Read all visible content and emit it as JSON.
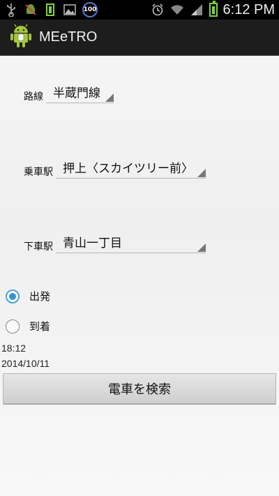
{
  "status_bar": {
    "icons_left": [
      "usb-icon",
      "android-debug-icon",
      "battery-100-icon",
      "image-icon",
      "badge-100-icon"
    ],
    "badge_text": "100",
    "icons_right": [
      "alarm-icon",
      "wifi-icon",
      "signal-icon",
      "battery-icon"
    ],
    "time": "6:12 PM"
  },
  "action_bar": {
    "title": "MEeTRO",
    "icon": "android-app-icon"
  },
  "form": {
    "line": {
      "label": "路線",
      "value": "半蔵門線"
    },
    "from": {
      "label": "乗車駅",
      "value": "押上〈スカイツリー前〉"
    },
    "to": {
      "label": "下車駅",
      "value": "青山一丁目"
    },
    "mode": {
      "options": [
        {
          "label": "出発",
          "checked": true
        },
        {
          "label": "到着",
          "checked": false
        }
      ]
    },
    "time": "18:12",
    "date": "2014/10/11",
    "search_label": "電車を検索"
  },
  "colors": {
    "accent": "#2e95d2",
    "actionbar": "#1d1d1d"
  }
}
